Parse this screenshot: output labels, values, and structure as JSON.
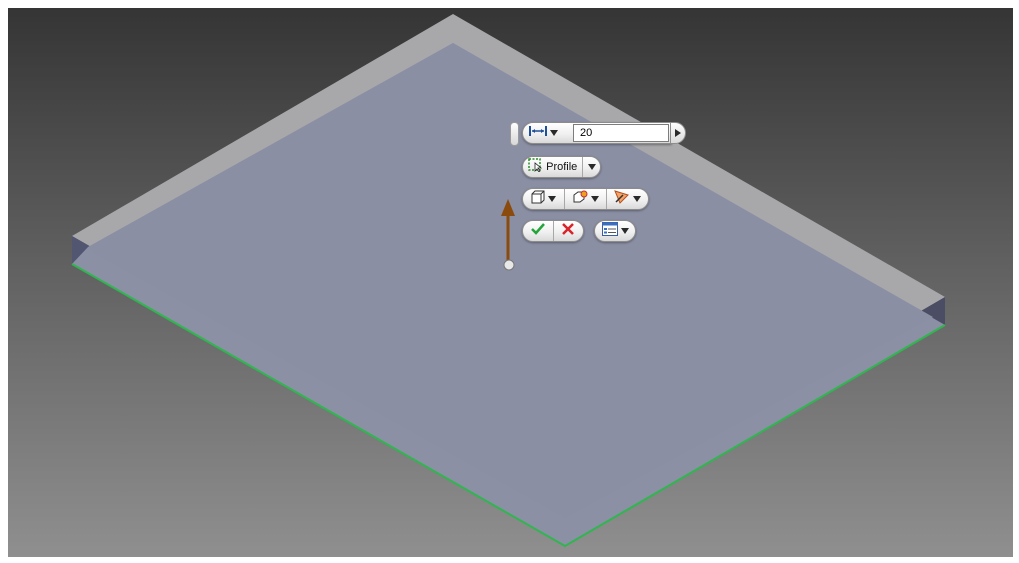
{
  "extrude_mini_toolbar": {
    "distance_value": "20",
    "profile_label": "Profile"
  },
  "icons": {
    "distance": "distance-icon",
    "profile": "profile-select-icon",
    "output": "solid-output-icon",
    "operation": "operation-icon",
    "direction": "direction-icon",
    "ok": "checkmark-icon",
    "cancel": "cancel-x-icon",
    "options": "options-list-icon"
  },
  "colors": {
    "top_face": "#8a8fa3",
    "side_face": "#4f5269",
    "preview_plane": "#a7a7aa",
    "edge_highlight": "#2fb64f",
    "arrow": "#8a4b0d",
    "ok": "#24a53a",
    "cancel": "#d8232a"
  }
}
